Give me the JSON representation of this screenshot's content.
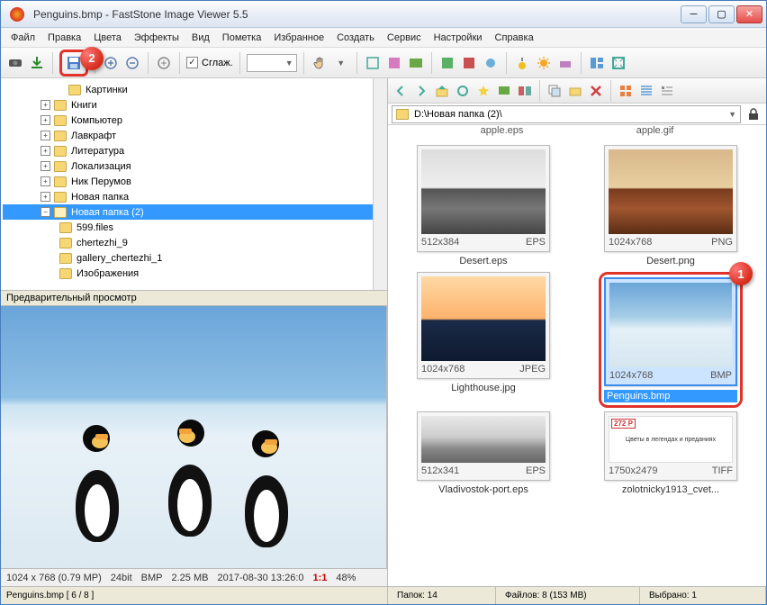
{
  "titlebar": {
    "title": "Penguins.bmp  -  FastStone Image Viewer 5.5"
  },
  "menus": [
    "Файл",
    "Правка",
    "Цвета",
    "Эффекты",
    "Вид",
    "Пометка",
    "Избранное",
    "Создать",
    "Сервис",
    "Настройки",
    "Справка"
  ],
  "toolbar": {
    "smooth_label": "Сглаж.",
    "dropdown_value": ""
  },
  "tree": [
    "Картинки",
    "Книги",
    "Компьютер",
    "Лавкрафт",
    "Литература",
    "Локализация",
    "Ник Перумов",
    "Новая папка"
  ],
  "tree_selected": "Новая папка (2)",
  "tree_children": [
    "599.files",
    "chertezhi_9",
    "gallery_chertezhi_1",
    "Изображения"
  ],
  "preview_header": "Предварительный просмотр",
  "info": {
    "dims": "1024 x 768 (0.79 MP)",
    "depth": "24bit",
    "fmt": "BMP",
    "size": "2.25 MB",
    "date": "2017-08-30 13:26:0",
    "ratio": "1:1",
    "pct": "48%"
  },
  "left_status": "Penguins.bmp [ 6 / 8 ]",
  "path": "D:\\Новая папка (2)\\",
  "thumbs": [
    {
      "meta": "512x384",
      "fmt": "EPS",
      "name": "Desert.eps",
      "title_top": "apple.eps"
    },
    {
      "meta": "1024x768",
      "fmt": "PNG",
      "name": "Desert.png",
      "title_top": "apple.gif"
    },
    {
      "meta": "1024x768",
      "fmt": "JPEG",
      "name": "Lighthouse.jpg"
    },
    {
      "meta": "1024x768",
      "fmt": "BMP",
      "name": "Penguins.bmp"
    },
    {
      "meta": "512x341",
      "fmt": "EPS",
      "name": "Vladivostok-port.eps"
    },
    {
      "meta": "1750x2479",
      "fmt": "TIFF",
      "name": "zolotnicky1913_cvet..."
    }
  ],
  "book_badge": "272 Р",
  "book_text": "Цветы в легендах и преданиях",
  "status": {
    "folders": "Папок: 14",
    "files": "Файлов: 8 (153 MB)",
    "selected": "Выбрано: 1"
  },
  "annotations": {
    "one": "1",
    "two": "2"
  }
}
